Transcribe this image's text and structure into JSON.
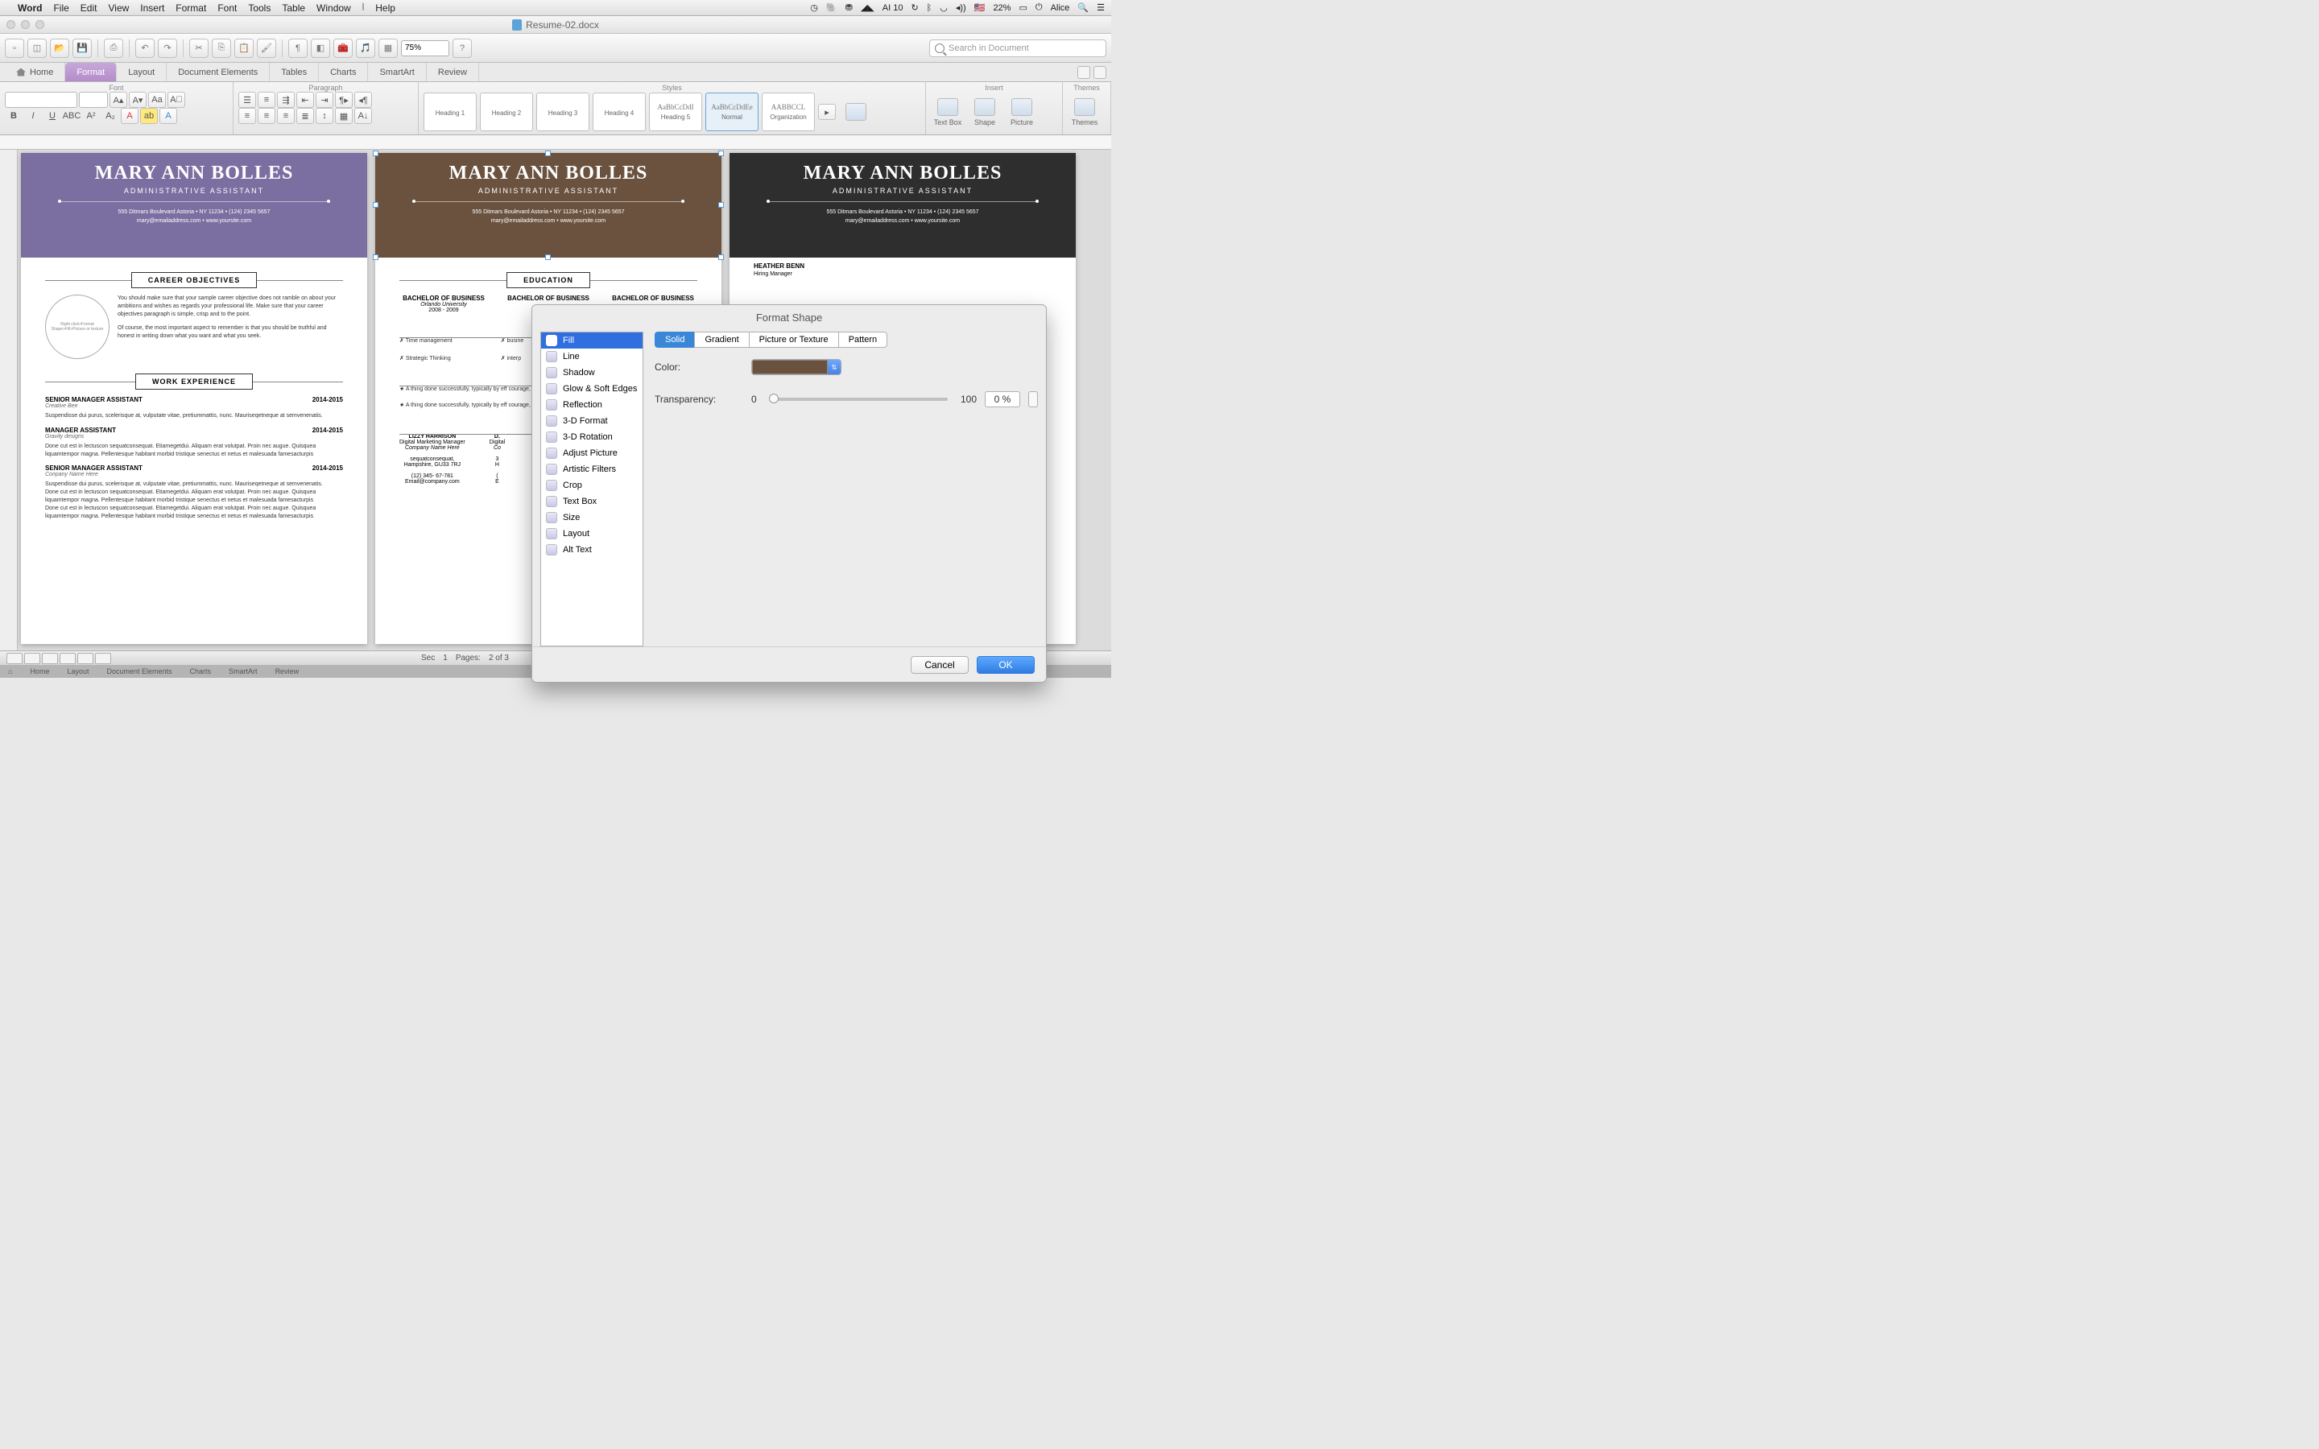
{
  "menubar": {
    "app": "Word",
    "items": [
      "File",
      "Edit",
      "View",
      "Insert",
      "Format",
      "Font",
      "Tools",
      "Table",
      "Window",
      "Help"
    ],
    "ai_label": "AI 10",
    "battery": "22%",
    "user": "Alice"
  },
  "window": {
    "title": "Resume-02.docx"
  },
  "toolbar": {
    "zoom": "75%",
    "search_placeholder": "Search in Document"
  },
  "ribbon_tabs": [
    "Home",
    "Format",
    "Layout",
    "Document Elements",
    "Tables",
    "Charts",
    "SmartArt",
    "Review"
  ],
  "ribbon": {
    "group_font": "Font",
    "group_para": "Paragraph",
    "group_styles": "Styles",
    "group_insert": "Insert",
    "group_themes": "Themes",
    "styles": [
      {
        "preview": "",
        "label": "Heading 1"
      },
      {
        "preview": "",
        "label": "Heading 2"
      },
      {
        "preview": "",
        "label": "Heading 3"
      },
      {
        "preview": "",
        "label": "Heading 4"
      },
      {
        "preview": "AaBbCcDdI",
        "label": "Heading 5"
      },
      {
        "preview": "AaBbCcDdEe",
        "label": "Normal"
      },
      {
        "preview": "AABBCCL",
        "label": "Organization"
      }
    ],
    "insert_items": [
      "Text Box",
      "Shape",
      "Picture",
      "Themes"
    ]
  },
  "resume": {
    "name": "MARY ANN BOLLES",
    "subtitle": "ADMINISTRATIVE ASSISTANT",
    "addr": "555 Ditmars Boulevard Astoria • NY 11234 • (124) 2345 5657",
    "email_line": "mary@emailaddress.com • www.yoursite.com",
    "career_title": "CAREER OBJECTIVES",
    "circle_hint": "Right click>Format Shape>Fill>Picture or texture",
    "obj_p1": "You should make sure that your sample career objective does not ramble on about your ambitions and wishes as regards your professional life. Make sure that your career objectives paragraph is simple, crisp and to the point.",
    "obj_p2": "Of course, the most important aspect to remember is that you should be truthful and honest in writing down what you want and what you seek.",
    "work_title": "WORK EXPERIENCE",
    "jobs": [
      {
        "title": "SENIOR MANAGER ASSISTANT",
        "dates": "2014-2015",
        "company": "Creative Bee",
        "desc": "Suspendisse dui purus, scelerisque at, vulputate vitae, pretiummattis, nunc. Mauriseqetneque at semvenenatis."
      },
      {
        "title": "MANAGER ASSISTANT",
        "dates": "2014-2015",
        "company": "Gravity designs",
        "desc": "Done cut est in lectuscon sequatconsequat. Etiamegetdui. Aliquam erat volutpat. Proin nec augue. Quisquea liquamtempor magna. Pellentesque habitant morbid tristique senectus et netus et malesuada famesacturpis"
      },
      {
        "title": "SENIOR MANAGER ASSISTANT",
        "dates": "2014-2015",
        "company": "Conpany Name Here",
        "desc": "Suspendisse dui purus, scelerisque at, vulputate vitae, pretiummattis, nunc. Mauriseqetneque at semvenenatis.\nDone cut est in lectuscon sequatconsequat. Etiamegetdui. Aliquam erat volutpat. Proin nec augue. Quisquea liquamtempor magna. Pellentesque habitant morbid tristique senectus et netus et malesuada famesacturpis\nDone cut est in lectuscon sequatconsequat. Etiamegetdui. Aliquam erat volutpat. Proin nec augue. Quisquea liquamtempor magna. Pellentesque habitant morbid tristique senectus et netus et malesuada famesacturpis"
      }
    ],
    "edu_title": "EDUCATION",
    "edu": {
      "degree": "BACHELOR OF BUSINESS",
      "uni": "Orlando University",
      "years": "2008 - 2009"
    },
    "skills": [
      "Time management",
      "Strategic Thinking"
    ],
    "skills_right": [
      "busine",
      "interp"
    ],
    "ach1": "★ A thing done successfully, typically by eff courage, or skill.",
    "ach2": "★ A thing done successfully, typically by eff courage, or skill.",
    "ref_name": "LIZZY HARRISON",
    "ref_role": "Digital Marketing Manager",
    "ref_co": "Company Name Here",
    "ref_addr1": "sequatconsequat,",
    "ref_addr2": "Hampshire, GU33 7RJ",
    "ref_ph": "(12) 345- 67-781",
    "ref_em": "Email@company.com",
    "ref2_name": "D.",
    "ref2_role": "Digital",
    "ref2_co": "Co",
    "ref2_misc1": "3",
    "ref2_misc2": "H",
    "ref2_misc3": "(",
    "ref2_misc4": "E",
    "p3_ref": "HEATHER BENN",
    "p3_role": "Hiring Manager"
  },
  "dialog": {
    "title": "Format Shape",
    "list": [
      "Fill",
      "Line",
      "Shadow",
      "Glow & Soft Edges",
      "Reflection",
      "3-D Format",
      "3-D Rotation",
      "Adjust Picture",
      "Artistic Filters",
      "Crop",
      "Text Box",
      "Size",
      "Layout",
      "Alt Text"
    ],
    "tabs": [
      "Solid",
      "Gradient",
      "Picture or Texture",
      "Pattern"
    ],
    "color_label": "Color:",
    "trans_label": "Transparency:",
    "min": "0",
    "max": "100",
    "pct": "0 %",
    "cancel": "Cancel",
    "ok": "OK",
    "swatch_color": "#6b523f"
  },
  "status": {
    "sec_label": "Sec",
    "sec": "1",
    "pages_label": "Pages:",
    "pages": "2 of 3"
  },
  "dimstrip": [
    "Home",
    "Layout",
    "Document Elements",
    "Charts",
    "SmartArt",
    "Review"
  ]
}
